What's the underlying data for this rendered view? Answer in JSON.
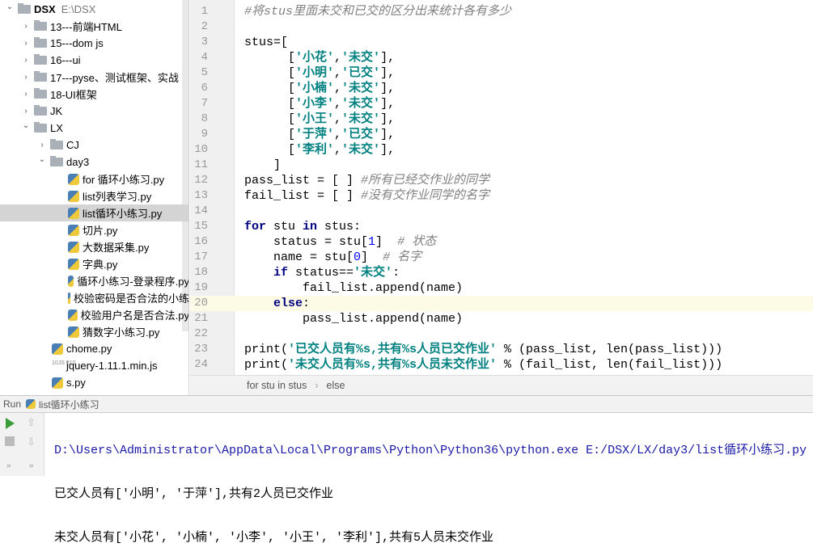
{
  "project_tree": [
    {
      "label": "DSX",
      "extra": "E:\\DSX",
      "type": "root",
      "expanded": true,
      "depth": 0
    },
    {
      "label": "13---前端HTML",
      "type": "folder",
      "depth": 1
    },
    {
      "label": "15---dom js",
      "type": "folder",
      "depth": 1
    },
    {
      "label": "16---ui",
      "type": "folder",
      "depth": 1
    },
    {
      "label": "17---pyse、测试框架、实战",
      "type": "folder",
      "depth": 1
    },
    {
      "label": "18-UI框架",
      "type": "folder",
      "depth": 1
    },
    {
      "label": "JK",
      "type": "folder",
      "depth": 1
    },
    {
      "label": "LX",
      "type": "folder",
      "expanded": true,
      "depth": 1
    },
    {
      "label": "CJ",
      "type": "folder",
      "depth": 2
    },
    {
      "label": "day3",
      "type": "folder",
      "expanded": true,
      "depth": 2
    },
    {
      "label": "for 循环小练习.py",
      "type": "py",
      "depth": 3
    },
    {
      "label": "list列表学习.py",
      "type": "py",
      "depth": 3
    },
    {
      "label": "list循环小练习.py",
      "type": "py",
      "depth": 3,
      "selected": true
    },
    {
      "label": "切片.py",
      "type": "py",
      "depth": 3
    },
    {
      "label": "大数据采集.py",
      "type": "py",
      "depth": 3
    },
    {
      "label": "字典.py",
      "type": "py",
      "depth": 3
    },
    {
      "label": "循环小练习-登录程序.py",
      "type": "py",
      "depth": 3
    },
    {
      "label": "校验密码是否合法的小练",
      "type": "py",
      "depth": 3
    },
    {
      "label": "校验用户名是否合法.py",
      "type": "py",
      "depth": 3
    },
    {
      "label": "猜数字小练习.py",
      "type": "py",
      "depth": 3
    },
    {
      "label": "chome.py",
      "type": "py",
      "depth": 2
    },
    {
      "label": "jquery-1.11.1.min.js",
      "type": "js",
      "depth": 2
    },
    {
      "label": "s.py",
      "type": "py",
      "depth": 2
    }
  ],
  "editor": {
    "current_line": 20,
    "lines": [
      [
        [
          "cm",
          "#将stus里面未交和已交的区分出来统计各有多少"
        ]
      ],
      [],
      [
        [
          "tx",
          "stus=["
        ]
      ],
      [
        [
          "tx",
          "      ["
        ],
        [
          "str",
          "'小花'"
        ],
        [
          "tx",
          ","
        ],
        [
          "str",
          "'未交'"
        ],
        [
          "tx",
          "],"
        ]
      ],
      [
        [
          "tx",
          "      ["
        ],
        [
          "str",
          "'小明'"
        ],
        [
          "tx",
          ","
        ],
        [
          "str",
          "'已交'"
        ],
        [
          "tx",
          "],"
        ]
      ],
      [
        [
          "tx",
          "      ["
        ],
        [
          "str",
          "'小楠'"
        ],
        [
          "tx",
          ","
        ],
        [
          "str",
          "'未交'"
        ],
        [
          "tx",
          "],"
        ]
      ],
      [
        [
          "tx",
          "      ["
        ],
        [
          "str",
          "'小李'"
        ],
        [
          "tx",
          ","
        ],
        [
          "str",
          "'未交'"
        ],
        [
          "tx",
          "],"
        ]
      ],
      [
        [
          "tx",
          "      ["
        ],
        [
          "str",
          "'小王'"
        ],
        [
          "tx",
          ","
        ],
        [
          "str",
          "'未交'"
        ],
        [
          "tx",
          "],"
        ]
      ],
      [
        [
          "tx",
          "      ["
        ],
        [
          "str",
          "'于萍'"
        ],
        [
          "tx",
          ","
        ],
        [
          "str",
          "'已交'"
        ],
        [
          "tx",
          "],"
        ]
      ],
      [
        [
          "tx",
          "      ["
        ],
        [
          "str",
          "'李利'"
        ],
        [
          "tx",
          ","
        ],
        [
          "str",
          "'未交'"
        ],
        [
          "tx",
          "],"
        ]
      ],
      [
        [
          "tx",
          "    ]"
        ]
      ],
      [
        [
          "tx",
          "pass_list = [ ] "
        ],
        [
          "cm",
          "#所有已经交作业的同学"
        ]
      ],
      [
        [
          "tx",
          "fail_list = [ ] "
        ],
        [
          "cm",
          "#没有交作业同学的名字"
        ]
      ],
      [],
      [
        [
          "kw",
          "for"
        ],
        [
          "tx",
          " stu "
        ],
        [
          "kw",
          "in"
        ],
        [
          "tx",
          " stus:"
        ]
      ],
      [
        [
          "tx",
          "    status = stu["
        ],
        [
          "num",
          "1"
        ],
        [
          "tx",
          "]  "
        ],
        [
          "cm",
          "# 状态"
        ]
      ],
      [
        [
          "tx",
          "    name = stu["
        ],
        [
          "num",
          "0"
        ],
        [
          "tx",
          "]  "
        ],
        [
          "cm",
          "# 名字"
        ]
      ],
      [
        [
          "tx",
          "    "
        ],
        [
          "kw",
          "if"
        ],
        [
          "tx",
          " status=="
        ],
        [
          "str",
          "'未交'"
        ],
        [
          "tx",
          ":"
        ]
      ],
      [
        [
          "tx",
          "        fail_list.append(name)"
        ]
      ],
      [
        [
          "tx",
          "    "
        ],
        [
          "kw",
          "else"
        ],
        [
          "tx",
          ":"
        ]
      ],
      [
        [
          "tx",
          "        pass_list.append(name)"
        ]
      ],
      [],
      [
        [
          "tx",
          "print("
        ],
        [
          "str",
          "'已交人员有%s,共有%s人员已交作业'"
        ],
        [
          "tx",
          " % (pass_list, len(pass_list)))"
        ]
      ],
      [
        [
          "tx",
          "print("
        ],
        [
          "str",
          "'未交人员有%s,共有%s人员未交作业'"
        ],
        [
          "tx",
          " % (fail_list, len(fail_list)))"
        ]
      ]
    ]
  },
  "breadcrumb": [
    "for stu in stus",
    "else"
  ],
  "run": {
    "label": "Run",
    "config": "list循环小练习",
    "output": [
      "D:\\Users\\Administrator\\AppData\\Local\\Programs\\Python\\Python36\\python.exe E:/DSX/LX/day3/list循环小练习.py",
      "已交人员有['小明', '于萍'],共有2人员已交作业",
      "未交人员有['小花', '小楠', '小李', '小王', '李利'],共有5人员未交作业"
    ]
  }
}
